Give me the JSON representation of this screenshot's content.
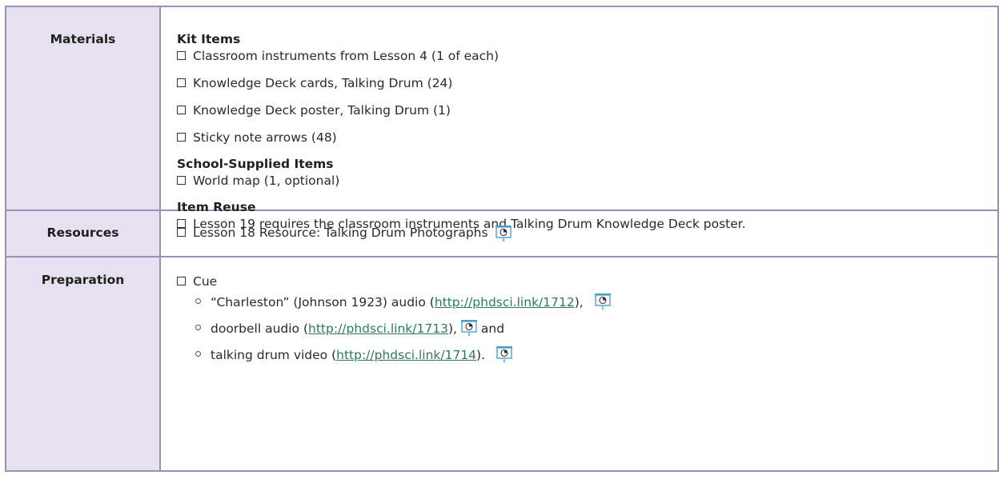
{
  "table": {
    "materials": {
      "label": "Materials",
      "kit_items": {
        "title": "Kit Items",
        "items": [
          "Classroom instruments from Lesson 4 (1 of each)",
          "Knowledge Deck cards, Talking Drum (24)",
          "Knowledge Deck poster, Talking Drum (1)",
          "Sticky note arrows (48)"
        ]
      },
      "school_supplied": {
        "title": "School-Supplied Items",
        "items": [
          "World map (1, optional)"
        ]
      },
      "item_reuse": {
        "title": "Item Reuse",
        "items": [
          "Lesson 19 requires the classroom instruments and Talking Drum Knowledge Deck poster."
        ]
      }
    },
    "resources": {
      "label": "Resources",
      "items": [
        "Lesson 18 Resource: Talking Drum Photographs"
      ],
      "icon": "projector-icon"
    },
    "preparation": {
      "label": "Preparation",
      "cue_label": "Cue",
      "sub_items": [
        {
          "before": "“Charleston” (Johnson 1923) audio (",
          "link": "http://phdsci.link/1712",
          "after": "),",
          "trail": ""
        },
        {
          "before": "doorbell audio (",
          "link": "http://phdsci.link/1713",
          "after": "),",
          "trail": "and"
        },
        {
          "before": "talking drum video (",
          "link": "http://phdsci.link/1714",
          "after": ").",
          "trail": ""
        }
      ],
      "icon": "projector-icon"
    },
    "colors": {
      "border": "#9b8fb8",
      "label_bg": "#e6e1ef",
      "link": "#2d7a5f",
      "icon_accent": "#4e9fd0"
    }
  }
}
